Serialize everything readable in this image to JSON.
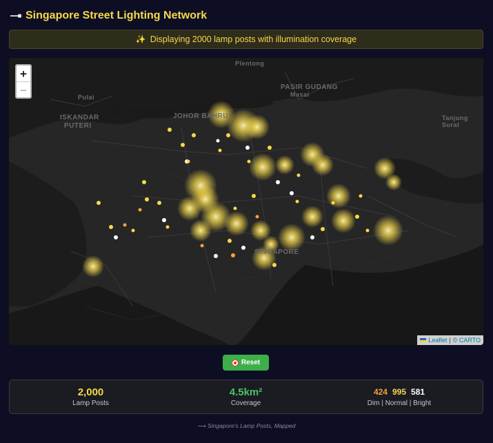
{
  "header": {
    "title": "Singapore Street Lighting Network",
    "icon": "lamp-post-icon"
  },
  "banner": {
    "icon": "sparkles-icon",
    "text": "Displaying 2000 lamp posts with illumination coverage"
  },
  "map": {
    "zoom_in": "+",
    "zoom_out": "−",
    "labels": {
      "plentong": "Plentong",
      "pasir_gudang": "PASIR GUDANG",
      "masai": "Masai",
      "pulai": "Pulai",
      "iskandar_puteri_1": "ISKANDAR",
      "iskandar_puteri_2": "PUTERI",
      "johor_bahru": "JOHOR BAHRU",
      "tanjung_surat": "Tanjung Surat",
      "singapore": "SINGAPORE"
    },
    "attribution": {
      "leaflet": "Leaflet",
      "separator": "|",
      "carto": "© CARTO"
    },
    "colors": {
      "dim": "#f2a33a",
      "normal": "#f5d94a",
      "bright": "#ffffff",
      "water": "#161616",
      "land": "#262626"
    }
  },
  "controls": {
    "reset_label": "Reset",
    "reset_icon": "target-icon"
  },
  "stats": {
    "lamp_posts": {
      "value": "2,000",
      "label": "Lamp Posts"
    },
    "coverage": {
      "value": "4.5km²",
      "label": "Coverage"
    },
    "brightness": {
      "dim": "424",
      "normal": "995",
      "bright": "581",
      "label": "Dim | Normal | Bright"
    }
  },
  "footer": {
    "text": "⟶ Singapore's Lamp Posts, Mapped"
  }
}
